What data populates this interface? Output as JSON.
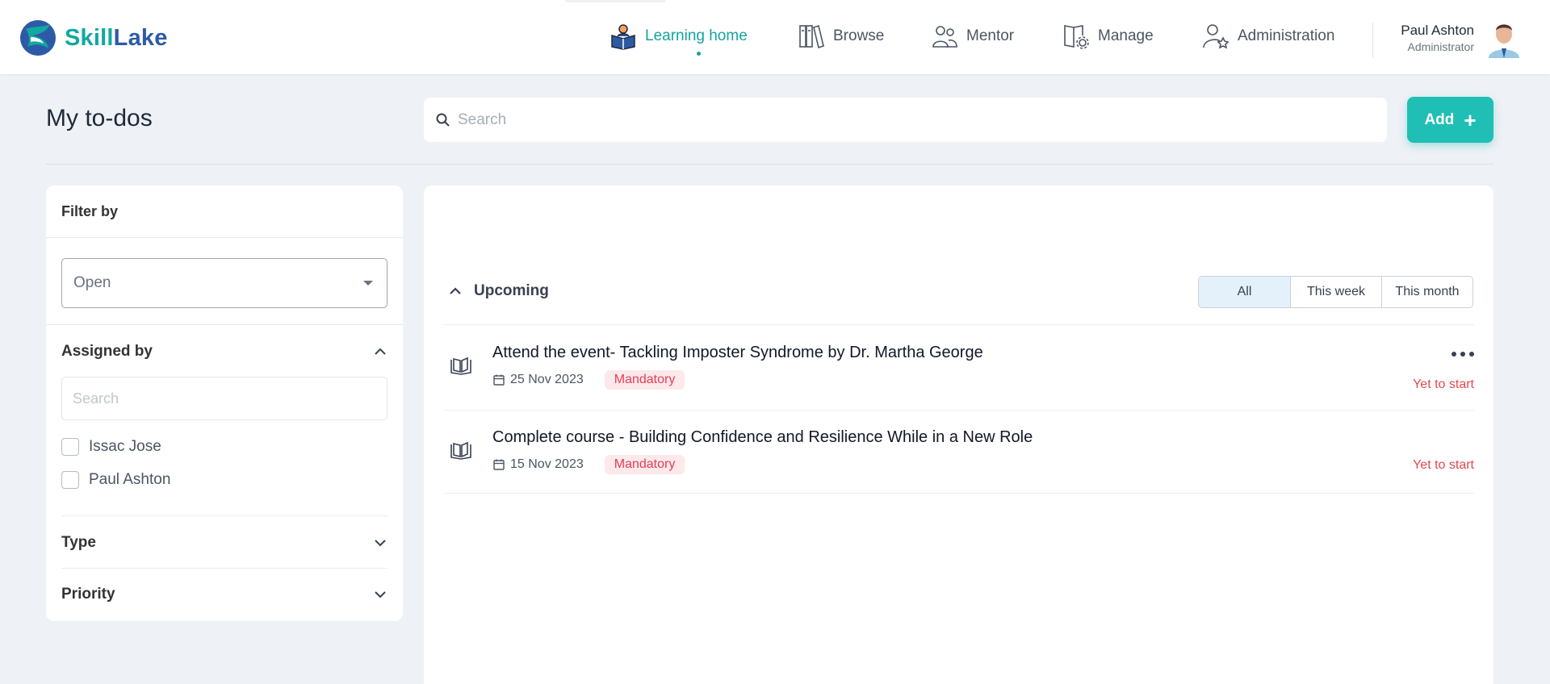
{
  "app": {
    "name_part1": "Skill",
    "name_part2": "Lake"
  },
  "nav": [
    {
      "label": "Learning home",
      "active": true,
      "icon": "reading-person-icon"
    },
    {
      "label": "Browse",
      "active": false,
      "icon": "books-icon"
    },
    {
      "label": "Mentor",
      "active": false,
      "icon": "people-icon"
    },
    {
      "label": "Manage",
      "active": false,
      "icon": "book-gear-icon"
    },
    {
      "label": "Administration",
      "active": false,
      "icon": "user-gear-icon"
    }
  ],
  "user": {
    "name": "Paul Ashton",
    "role": "Administrator"
  },
  "page": {
    "title": "My to-dos",
    "search_placeholder": "Search",
    "add_label": "Add"
  },
  "filter": {
    "title": "Filter by",
    "status_value": "Open",
    "assigned_by": {
      "label": "Assigned by",
      "search_placeholder": "Search",
      "options": [
        "Issac Jose",
        "Paul Ashton"
      ]
    },
    "type_label": "Type",
    "priority_label": "Priority"
  },
  "upcoming": {
    "label": "Upcoming",
    "ranges": [
      "All",
      "This week",
      "This month"
    ],
    "active_range": "All",
    "items": [
      {
        "title": "Attend the event- Tackling Imposter Syndrome by Dr. Martha George",
        "date": "25 Nov 2023",
        "badge": "Mandatory",
        "status": "Yet to start"
      },
      {
        "title": "Complete course - Building Confidence and Resilience While in a New Role",
        "date": "15 Nov 2023",
        "badge": "Mandatory",
        "status": "Yet to start"
      }
    ]
  },
  "colors": {
    "accent": "#14a3a0",
    "brand_blue": "#2d5aa7",
    "add_button": "#1fbfb5",
    "status_red": "#e5484d",
    "badge_bg": "#fde8ea"
  }
}
